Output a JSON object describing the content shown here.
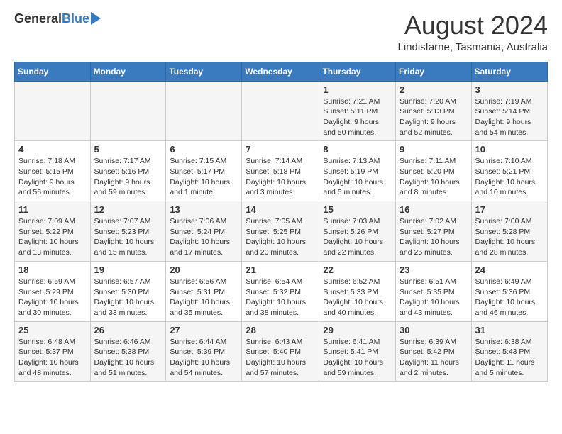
{
  "header": {
    "logo_general": "General",
    "logo_blue": "Blue",
    "main_title": "August 2024",
    "subtitle": "Lindisfarne, Tasmania, Australia"
  },
  "calendar": {
    "days_of_week": [
      "Sunday",
      "Monday",
      "Tuesday",
      "Wednesday",
      "Thursday",
      "Friday",
      "Saturday"
    ],
    "weeks": [
      [
        {
          "day": "",
          "info": ""
        },
        {
          "day": "",
          "info": ""
        },
        {
          "day": "",
          "info": ""
        },
        {
          "day": "",
          "info": ""
        },
        {
          "day": "1",
          "info": "Sunrise: 7:21 AM\nSunset: 5:11 PM\nDaylight: 9 hours and 50 minutes."
        },
        {
          "day": "2",
          "info": "Sunrise: 7:20 AM\nSunset: 5:13 PM\nDaylight: 9 hours and 52 minutes."
        },
        {
          "day": "3",
          "info": "Sunrise: 7:19 AM\nSunset: 5:14 PM\nDaylight: 9 hours and 54 minutes."
        }
      ],
      [
        {
          "day": "4",
          "info": "Sunrise: 7:18 AM\nSunset: 5:15 PM\nDaylight: 9 hours and 56 minutes."
        },
        {
          "day": "5",
          "info": "Sunrise: 7:17 AM\nSunset: 5:16 PM\nDaylight: 9 hours and 59 minutes."
        },
        {
          "day": "6",
          "info": "Sunrise: 7:15 AM\nSunset: 5:17 PM\nDaylight: 10 hours and 1 minute."
        },
        {
          "day": "7",
          "info": "Sunrise: 7:14 AM\nSunset: 5:18 PM\nDaylight: 10 hours and 3 minutes."
        },
        {
          "day": "8",
          "info": "Sunrise: 7:13 AM\nSunset: 5:19 PM\nDaylight: 10 hours and 5 minutes."
        },
        {
          "day": "9",
          "info": "Sunrise: 7:11 AM\nSunset: 5:20 PM\nDaylight: 10 hours and 8 minutes."
        },
        {
          "day": "10",
          "info": "Sunrise: 7:10 AM\nSunset: 5:21 PM\nDaylight: 10 hours and 10 minutes."
        }
      ],
      [
        {
          "day": "11",
          "info": "Sunrise: 7:09 AM\nSunset: 5:22 PM\nDaylight: 10 hours and 13 minutes."
        },
        {
          "day": "12",
          "info": "Sunrise: 7:07 AM\nSunset: 5:23 PM\nDaylight: 10 hours and 15 minutes."
        },
        {
          "day": "13",
          "info": "Sunrise: 7:06 AM\nSunset: 5:24 PM\nDaylight: 10 hours and 17 minutes."
        },
        {
          "day": "14",
          "info": "Sunrise: 7:05 AM\nSunset: 5:25 PM\nDaylight: 10 hours and 20 minutes."
        },
        {
          "day": "15",
          "info": "Sunrise: 7:03 AM\nSunset: 5:26 PM\nDaylight: 10 hours and 22 minutes."
        },
        {
          "day": "16",
          "info": "Sunrise: 7:02 AM\nSunset: 5:27 PM\nDaylight: 10 hours and 25 minutes."
        },
        {
          "day": "17",
          "info": "Sunrise: 7:00 AM\nSunset: 5:28 PM\nDaylight: 10 hours and 28 minutes."
        }
      ],
      [
        {
          "day": "18",
          "info": "Sunrise: 6:59 AM\nSunset: 5:29 PM\nDaylight: 10 hours and 30 minutes."
        },
        {
          "day": "19",
          "info": "Sunrise: 6:57 AM\nSunset: 5:30 PM\nDaylight: 10 hours and 33 minutes."
        },
        {
          "day": "20",
          "info": "Sunrise: 6:56 AM\nSunset: 5:31 PM\nDaylight: 10 hours and 35 minutes."
        },
        {
          "day": "21",
          "info": "Sunrise: 6:54 AM\nSunset: 5:32 PM\nDaylight: 10 hours and 38 minutes."
        },
        {
          "day": "22",
          "info": "Sunrise: 6:52 AM\nSunset: 5:33 PM\nDaylight: 10 hours and 40 minutes."
        },
        {
          "day": "23",
          "info": "Sunrise: 6:51 AM\nSunset: 5:35 PM\nDaylight: 10 hours and 43 minutes."
        },
        {
          "day": "24",
          "info": "Sunrise: 6:49 AM\nSunset: 5:36 PM\nDaylight: 10 hours and 46 minutes."
        }
      ],
      [
        {
          "day": "25",
          "info": "Sunrise: 6:48 AM\nSunset: 5:37 PM\nDaylight: 10 hours and 48 minutes."
        },
        {
          "day": "26",
          "info": "Sunrise: 6:46 AM\nSunset: 5:38 PM\nDaylight: 10 hours and 51 minutes."
        },
        {
          "day": "27",
          "info": "Sunrise: 6:44 AM\nSunset: 5:39 PM\nDaylight: 10 hours and 54 minutes."
        },
        {
          "day": "28",
          "info": "Sunrise: 6:43 AM\nSunset: 5:40 PM\nDaylight: 10 hours and 57 minutes."
        },
        {
          "day": "29",
          "info": "Sunrise: 6:41 AM\nSunset: 5:41 PM\nDaylight: 10 hours and 59 minutes."
        },
        {
          "day": "30",
          "info": "Sunrise: 6:39 AM\nSunset: 5:42 PM\nDaylight: 11 hours and 2 minutes."
        },
        {
          "day": "31",
          "info": "Sunrise: 6:38 AM\nSunset: 5:43 PM\nDaylight: 11 hours and 5 minutes."
        }
      ]
    ]
  }
}
